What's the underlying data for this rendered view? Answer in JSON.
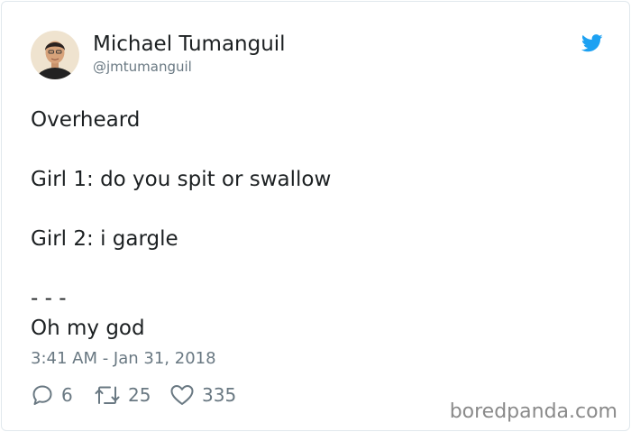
{
  "tweet": {
    "author_name": "Michael Tumanguil",
    "author_handle": "@jmtumanguil",
    "lines": [
      "Overheard",
      "Girl 1: do you spit or swallow",
      "Girl 2: i gargle",
      "- - -",
      "Oh my god"
    ],
    "timestamp": "3:41 AM - Jan 31, 2018",
    "actions": {
      "reply_count": "6",
      "retweet_count": "25",
      "like_count": "335"
    }
  },
  "watermark": "boredpanda.com",
  "colors": {
    "twitter_blue": "#1da1f2",
    "secondary_text": "#697882",
    "primary_text": "#1c2022"
  },
  "icons": {
    "brand": "twitter-bird-icon",
    "reply": "reply-icon",
    "retweet": "retweet-icon",
    "like": "heart-icon"
  }
}
